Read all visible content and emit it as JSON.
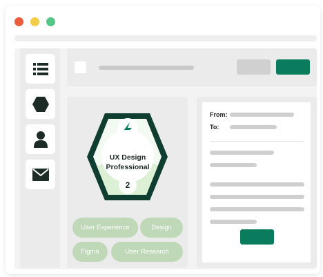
{
  "window": {
    "controls": [
      {
        "name": "close",
        "color": "#ec5b3a"
      },
      {
        "name": "minimize",
        "color": "#f4cd47"
      },
      {
        "name": "maximize",
        "color": "#55c789"
      }
    ]
  },
  "sidebar": {
    "items": [
      {
        "icon": "list-icon"
      },
      {
        "icon": "hexagon-icon"
      },
      {
        "icon": "user-icon"
      },
      {
        "icon": "mail-icon"
      }
    ]
  },
  "badge": {
    "title_line1": "UX Design",
    "title_line2": "Professional",
    "level": "2",
    "icon": "lightning-bolt-icon",
    "tags": [
      "User Experience",
      "Design",
      "Figma",
      "User Research"
    ]
  },
  "email": {
    "from_label": "From:",
    "to_label": "To:"
  },
  "colors": {
    "accent_green": "#0a7b5c",
    "badge_outline": "#0f3d30",
    "tag_fill": "#bfd9b8"
  }
}
